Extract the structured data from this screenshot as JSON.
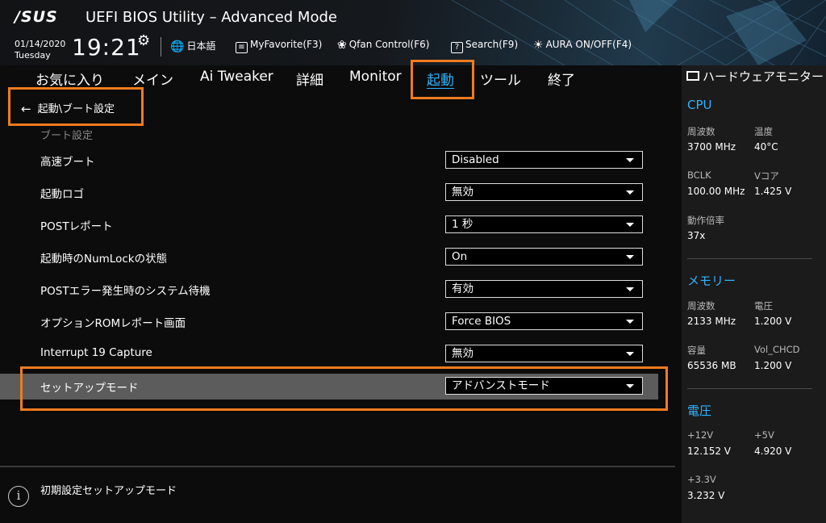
{
  "header": {
    "brand": "/SUS",
    "title": "UEFI BIOS Utility – Advanced Mode",
    "date": "01/14/2020",
    "day": "Tuesday",
    "time": "19:21",
    "language": "日本語",
    "myfavorite": "MyFavorite(F3)",
    "qfan": "Qfan Control(F6)",
    "search": "Search(F9)",
    "aura": "AURA ON/OFF(F4)"
  },
  "tabs": [
    {
      "label": "お気に入り"
    },
    {
      "label": "メイン"
    },
    {
      "label": "Ai Tweaker"
    },
    {
      "label": "詳細"
    },
    {
      "label": "Monitor"
    },
    {
      "label": "起動"
    },
    {
      "label": "ツール"
    },
    {
      "label": "終了"
    }
  ],
  "active_tab": "起動",
  "breadcrumb": "起動\\ブート設定",
  "section_label": "ブート設定",
  "settings": [
    {
      "label": "高速ブート",
      "value": "Disabled"
    },
    {
      "label": "起動ロゴ",
      "value": "無効"
    },
    {
      "label": "POSTレポート",
      "value": "1 秒"
    },
    {
      "label": "起動時のNumLockの状態",
      "value": "On"
    },
    {
      "label": "POSTエラー発生時のシステム待機",
      "value": "有効"
    },
    {
      "label": "オプションROMレポート画面",
      "value": "Force BIOS"
    },
    {
      "label": "Interrupt 19 Capture",
      "value": "無効"
    },
    {
      "label": "セットアップモード",
      "value": "アドバンストモード"
    }
  ],
  "help_text": "初期設定セットアップモード",
  "hw_monitor": {
    "title": "ハードウェアモニター",
    "cpu": {
      "section": "CPU",
      "freq_label": "周波数",
      "freq_value": "3700 MHz",
      "temp_label": "温度",
      "temp_value": "40°C",
      "bclk_label": "BCLK",
      "bclk_value": "100.00 MHz",
      "vcore_label": "Vコア",
      "vcore_value": "1.425 V",
      "ratio_label": "動作倍率",
      "ratio_value": "37x"
    },
    "memory": {
      "section": "メモリー",
      "freq_label": "周波数",
      "freq_value": "2133 MHz",
      "volt_label": "電圧",
      "volt_value": "1.200 V",
      "cap_label": "容量",
      "cap_value": "65536 MB",
      "vol_chcd_label": "Vol_CHCD",
      "vol_chcd_value": "1.200 V"
    },
    "voltage": {
      "section": "電圧",
      "v12_label": "+12V",
      "v12_value": "12.152 V",
      "v5_label": "+5V",
      "v5_value": "4.920 V",
      "v33_label": "+3.3V",
      "v33_value": "3.232 V"
    }
  },
  "colors": {
    "accent": "#2fb3ff",
    "highlight": "#f07b1f",
    "selected_row": "#5c5c5c"
  }
}
